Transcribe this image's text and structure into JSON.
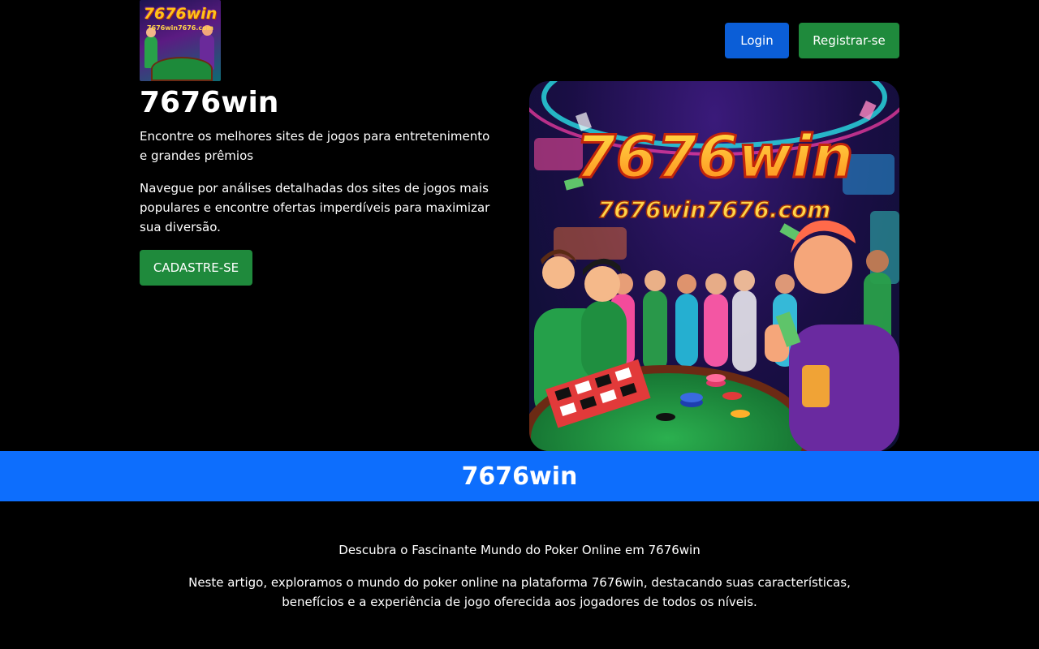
{
  "header": {
    "logo": {
      "title": "7676win",
      "subtitle": "7676win7676.com"
    },
    "login_label": "Login",
    "register_label": "Registrar-se"
  },
  "hero": {
    "title": "7676win",
    "lead": "Encontre os melhores sites de jogos para entretenimento e grandes prêmios",
    "description": "Navegue por análises detalhadas dos sites de jogos mais populares e encontre ofertas imperdíveis para maximizar sua diversão.",
    "cta_label": "CADASTRE-SE",
    "image": {
      "title": "7676win",
      "subtitle": "7676win7676.com"
    }
  },
  "banner": {
    "title": "7676win"
  },
  "article": {
    "heading": "Descubra o Fascinante Mundo do Poker Online em 7676win",
    "body": "Neste artigo, exploramos o mundo do poker online na plataforma 7676win, destacando suas características, benefícios e a experiência de jogo oferecida aos jogadores de todos os níveis."
  },
  "colors": {
    "background": "#000000",
    "login_button": "#0b5ed7",
    "register_button": "#1f8a3c",
    "banner": "#0d6efd"
  }
}
